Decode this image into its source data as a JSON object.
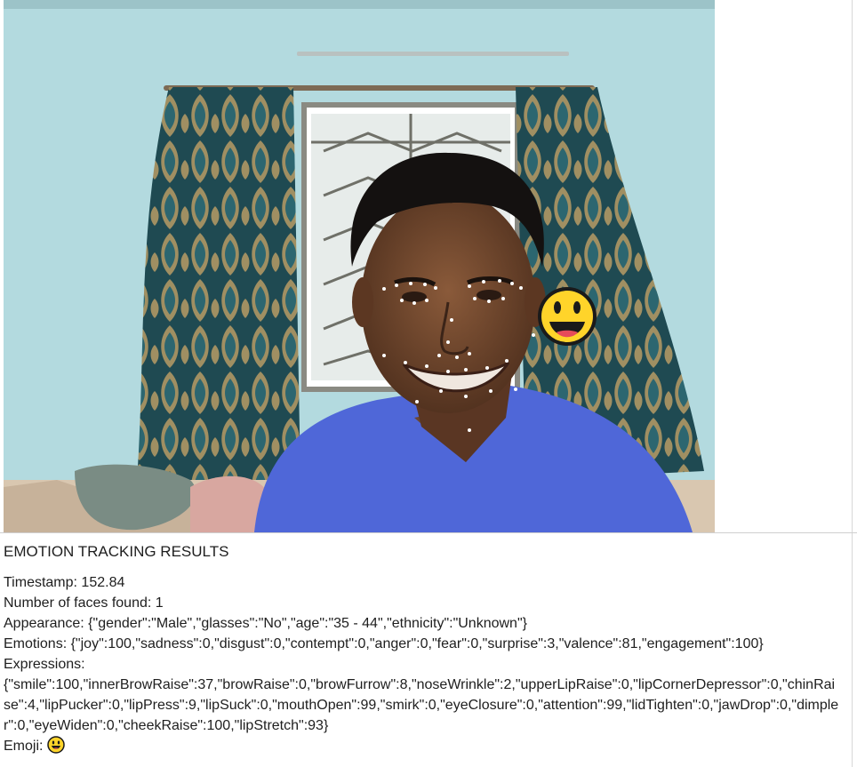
{
  "webcam": {
    "emoji_overlay": "grinning-face-emoji"
  },
  "results": {
    "heading": "EMOTION TRACKING RESULTS",
    "timestamp": "Timestamp: 152.84",
    "faces": "Number of faces found: 1",
    "appearance": "Appearance: {\"gender\":\"Male\",\"glasses\":\"No\",\"age\":\"35 - 44\",\"ethnicity\":\"Unknown\"}",
    "emotions": "Emotions: {\"joy\":100,\"sadness\":0,\"disgust\":0,\"contempt\":0,\"anger\":0,\"fear\":0,\"surprise\":3,\"valence\":81,\"engagement\":100}",
    "expressions_label": "Expressions:",
    "expressions": "{\"smile\":100,\"innerBrowRaise\":37,\"browRaise\":0,\"browFurrow\":8,\"noseWrinkle\":2,\"upperLipRaise\":0,\"lipCornerDepressor\":0,\"chinRaise\":4,\"lipPucker\":0,\"lipPress\":9,\"lipSuck\":0,\"mouthOpen\":99,\"smirk\":0,\"eyeClosure\":0,\"attention\":99,\"lidTighten\":0,\"jawDrop\":0,\"dimpler\":0,\"eyeWiden\":0,\"cheekRaise\":100,\"lipStretch\":93}",
    "emoji_label": "Emoji:",
    "emoji_icon": "grinning-face-emoji"
  }
}
